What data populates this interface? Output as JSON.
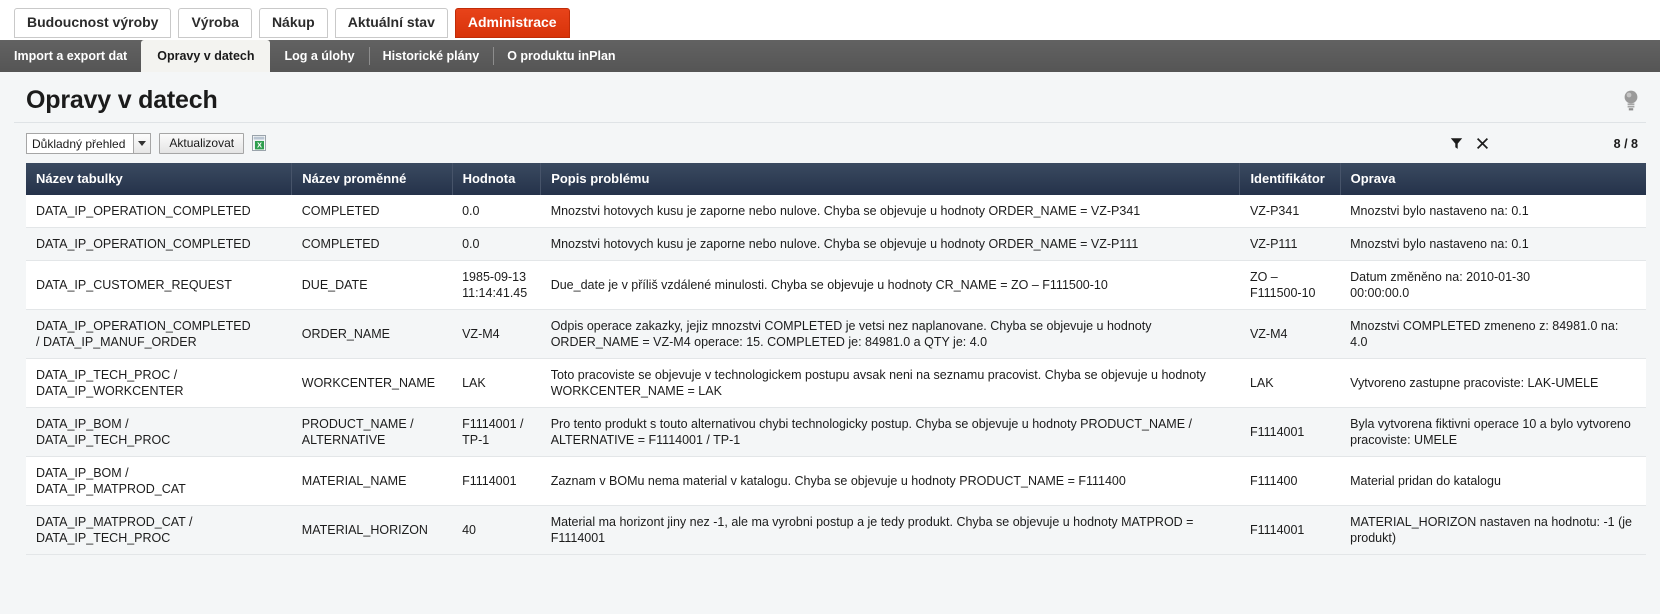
{
  "top_nav": {
    "items": [
      {
        "label": "Budoucnost výroby",
        "active": false
      },
      {
        "label": "Výroba",
        "active": false
      },
      {
        "label": "Nákup",
        "active": false
      },
      {
        "label": "Aktuální stav",
        "active": false
      },
      {
        "label": "Administrace",
        "active": true
      }
    ],
    "active_color": "#d8330a"
  },
  "sub_nav": {
    "items": [
      {
        "label": "Import a export dat",
        "active": false
      },
      {
        "label": "Opravy v datech",
        "active": true
      },
      {
        "label": "Log a úlohy",
        "active": false
      },
      {
        "label": "Historické plány",
        "active": false
      },
      {
        "label": "O produktu inPlan",
        "active": false
      }
    ]
  },
  "page": {
    "title": "Opravy v datech",
    "hint_icon": "lightbulb-icon"
  },
  "toolbar": {
    "view_select_value": "Důkladný přehled",
    "refresh_label": "Aktualizovat",
    "export_icon": "excel-export-icon",
    "filter_icon": "filter-icon",
    "clear_filter_icon": "close-icon",
    "record_count": "8 / 8"
  },
  "table": {
    "columns": [
      "Název tabulky",
      "Název proměnné",
      "Hodnota",
      "Popis problému",
      "Identifikátor",
      "Oprava"
    ],
    "rows": [
      {
        "table_name": "DATA_IP_OPERATION_COMPLETED",
        "variable_name": "COMPLETED",
        "value": "0.0",
        "description": "Mnozstvi hotovych kusu je zaporne nebo nulove. Chyba se objevuje u hodnoty ORDER_NAME = VZ-P341",
        "identifier": "VZ-P341",
        "fix": "Mnozstvi bylo nastaveno na: 0.1"
      },
      {
        "table_name": "DATA_IP_OPERATION_COMPLETED",
        "variable_name": "COMPLETED",
        "value": "0.0",
        "description": "Mnozstvi hotovych kusu je zaporne nebo nulove. Chyba se objevuje u hodnoty ORDER_NAME = VZ-P111",
        "identifier": "VZ-P111",
        "fix": "Mnozstvi bylo nastaveno na: 0.1"
      },
      {
        "table_name": "DATA_IP_CUSTOMER_REQUEST",
        "variable_name": "DUE_DATE",
        "value": "1985-09-13\n11:14:41.45",
        "description": "Due_date je v příliš vzdálené minulosti. Chyba se objevuje u hodnoty CR_NAME = ZO – F111500-10",
        "identifier": "ZO –\nF111500-10",
        "fix": "Datum změněno na: 2010-01-30\n00:00:00.0"
      },
      {
        "table_name": "DATA_IP_OPERATION_COMPLETED\n/ DATA_IP_MANUF_ORDER",
        "variable_name": "ORDER_NAME",
        "value": "VZ-M4",
        "description": "Odpis operace zakazky, jejiz mnozstvi COMPLETED je vetsi nez naplanovane. Chyba se objevuje u hodnoty ORDER_NAME = VZ-M4 operace: 15. COMPLETED je: 84981.0 a QTY je: 4.0",
        "identifier": "VZ-M4",
        "fix": "Mnozstvi COMPLETED zmeneno z: 84981.0 na: 4.0"
      },
      {
        "table_name": "DATA_IP_TECH_PROC /\nDATA_IP_WORKCENTER",
        "variable_name": "WORKCENTER_NAME",
        "value": "LAK",
        "description": "Toto pracoviste se objevuje v technologickem postupu avsak neni na seznamu pracovist. Chyba se objevuje u hodnoty WORKCENTER_NAME = LAK",
        "identifier": "LAK",
        "fix": "Vytvoreno zastupne pracoviste: LAK-UMELE"
      },
      {
        "table_name": "DATA_IP_BOM /\nDATA_IP_TECH_PROC",
        "variable_name": "PRODUCT_NAME /\nALTERNATIVE",
        "value": "F1114001 /\nTP-1",
        "description": "Pro tento produkt s touto alternativou chybi technologicky postup. Chyba se objevuje u hodnoty PRODUCT_NAME / ALTERNATIVE = F1114001 / TP-1",
        "identifier": "F1114001",
        "fix": "Byla vytvorena fiktivni operace 10 a bylo vytvoreno pracoviste: UMELE"
      },
      {
        "table_name": "DATA_IP_BOM /\nDATA_IP_MATPROD_CAT",
        "variable_name": "MATERIAL_NAME",
        "value": "F1114001",
        "description": "Zaznam v BOMu nema material v katalogu. Chyba se objevuje u hodnoty PRODUCT_NAME = F111400",
        "identifier": "F111400",
        "fix": "Material pridan do katalogu"
      },
      {
        "table_name": "DATA_IP_MATPROD_CAT /\nDATA_IP_TECH_PROC",
        "variable_name": "MATERIAL_HORIZON",
        "value": "40",
        "description": "Material ma horizont jiny nez -1, ale ma vyrobni postup a je tedy produkt. Chyba se objevuje u hodnoty MATPROD = F1114001",
        "identifier": "F1114001",
        "fix": "MATERIAL_HORIZON nastaven na hodnotu: -1 (je produkt)"
      }
    ]
  }
}
